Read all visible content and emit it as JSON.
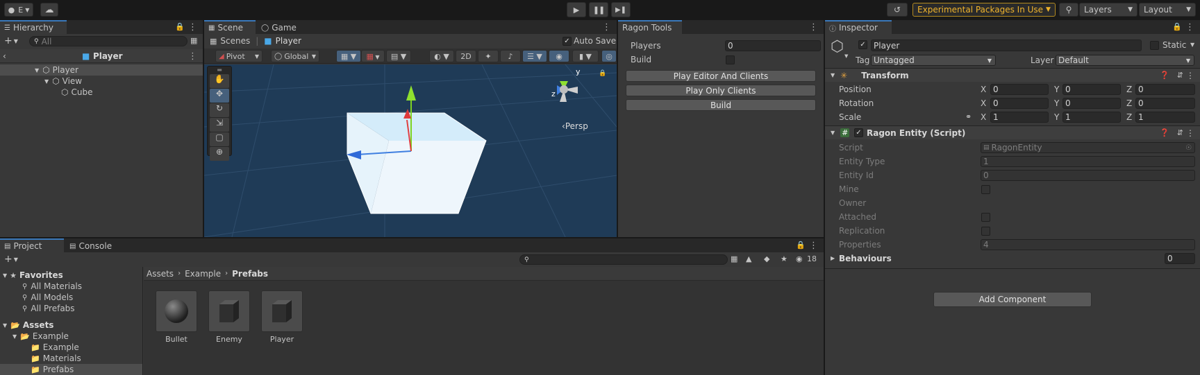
{
  "topbar": {
    "account_label": "E",
    "experimental_label": "Experimental Packages In Use",
    "layers_label": "Layers",
    "layout_label": "Layout"
  },
  "hierarchy": {
    "tab": "Hierarchy",
    "search_placeholder": "All",
    "header_title": "Player",
    "items": [
      {
        "label": "Player"
      },
      {
        "label": "View"
      },
      {
        "label": "Cube"
      }
    ]
  },
  "scene": {
    "tabs": [
      "Scene",
      "Game"
    ],
    "breadcrumb_scenes": "Scenes",
    "breadcrumb_player": "Player",
    "auto_save": "Auto Save",
    "pivot": "Pivot",
    "global": "Global",
    "mode_2d": "2D",
    "persp": "Persp",
    "gizmo_y": "y",
    "gizmo_z": "z"
  },
  "ragon": {
    "tab": "Ragon Tools",
    "players_label": "Players",
    "players_value": "0",
    "build_label": "Build",
    "buttons": [
      "Play Editor And Clients",
      "Play Only Clients",
      "Build"
    ]
  },
  "inspector": {
    "tab": "Inspector",
    "object_name": "Player",
    "static_label": "Static",
    "tag_label": "Tag",
    "tag_value": "Untagged",
    "layer_label": "Layer",
    "layer_value": "Default",
    "transform": {
      "title": "Transform",
      "rows": [
        {
          "label": "Position",
          "x": "0",
          "y": "0",
          "z": "0"
        },
        {
          "label": "Rotation",
          "x": "0",
          "y": "0",
          "z": "0"
        },
        {
          "label": "Scale",
          "x": "1",
          "y": "1",
          "z": "1"
        }
      ]
    },
    "ragon_entity": {
      "title": "Ragon Entity (Script)",
      "script_label": "Script",
      "script_value": "RagonEntity",
      "entity_type_label": "Entity Type",
      "entity_type_value": "1",
      "entity_id_label": "Entity Id",
      "entity_id_value": "0",
      "mine_label": "Mine",
      "owner_label": "Owner",
      "attached_label": "Attached",
      "replication_label": "Replication",
      "properties_label": "Properties",
      "properties_value": "4",
      "behaviours_label": "Behaviours",
      "behaviours_value": "0"
    },
    "add_component": "Add Component"
  },
  "project": {
    "tabs": [
      "Project",
      "Console"
    ],
    "hidden_count": "18",
    "breadcrumb": [
      "Assets",
      "Example",
      "Prefabs"
    ],
    "favorites_label": "Favorites",
    "favorites": [
      "All Materials",
      "All Models",
      "All Prefabs"
    ],
    "assets_label": "Assets",
    "tree": [
      {
        "label": "Example"
      },
      {
        "label": "Example"
      },
      {
        "label": "Materials"
      },
      {
        "label": "Prefabs"
      }
    ],
    "assets": [
      "Bullet",
      "Enemy",
      "Player"
    ]
  },
  "colors": {
    "accent": "#3a79bb",
    "experimental": "#f0b42c",
    "scene_bg": "#1f3b57"
  }
}
